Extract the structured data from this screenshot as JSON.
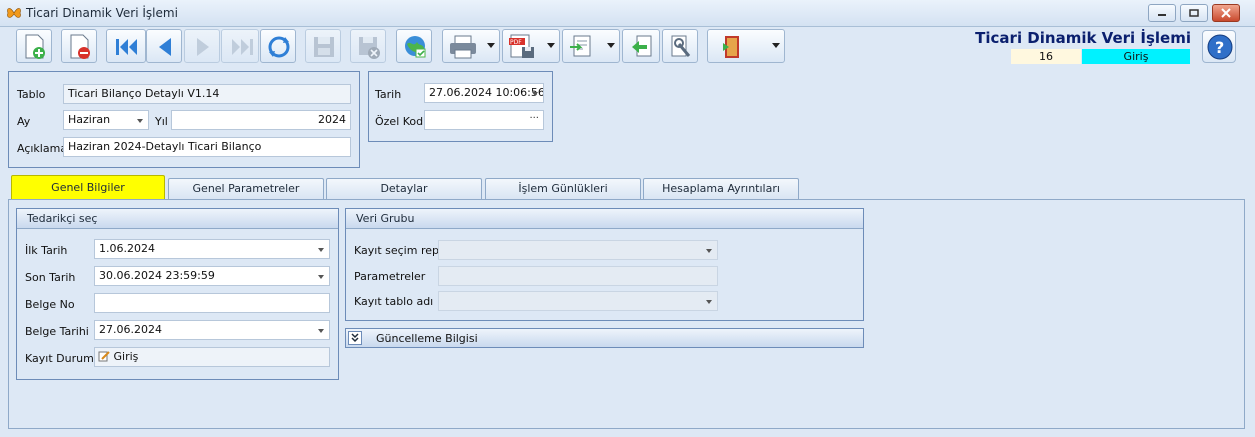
{
  "window": {
    "title": "Ticari Dinamik Veri İşlemi"
  },
  "header": {
    "title": "Ticari Dinamik Veri İşlemi",
    "count": "16",
    "status": "Giriş"
  },
  "form": {
    "tablo_label": "Tablo",
    "tablo_value": "Ticari Bilanço Detaylı V1.14",
    "ay_label": "Ay",
    "ay_value": "Haziran",
    "yil_label": "Yıl",
    "yil_value": "2024",
    "aciklama_label": "Açıklama",
    "aciklama_value": "Haziran 2024-Detaylı Ticari Bilanço",
    "tarih_label": "Tarih",
    "tarih_value": "27.06.2024 10:06:56",
    "ozel_kod_label": "Özel Kod",
    "ozel_kod_value": ""
  },
  "tabs": [
    {
      "label": "Genel Bilgiler"
    },
    {
      "label": "Genel Parametreler"
    },
    {
      "label": "Detaylar"
    },
    {
      "label": "İşlem Günlükleri"
    },
    {
      "label": "Hesaplama Ayrıntıları"
    }
  ],
  "supplier": {
    "title": "Tedarikçi seç",
    "ilk_tarih_label": "İlk Tarih",
    "ilk_tarih_value": "1.06.2024",
    "son_tarih_label": "Son Tarih",
    "son_tarih_value": "30.06.2024 23:59:59",
    "belge_no_label": "Belge No",
    "belge_no_value": "",
    "belge_tarihi_label": "Belge Tarihi",
    "belge_tarihi_value": "27.06.2024",
    "kayit_durumu_label": "Kayıt Durumu",
    "kayit_durumu_value": "Giriş"
  },
  "data_group": {
    "title": "Veri Grubu",
    "repo_label": "Kayıt seçim repo",
    "repo_value": "",
    "params_label": "Parametreler",
    "params_value": "",
    "table_label": "Kayıt tablo adı",
    "table_value": ""
  },
  "update_info": {
    "label": "Güncelleme Bilgisi"
  },
  "toolbar_icons": [
    "new-document-icon",
    "delete-document-icon",
    "first-record-icon",
    "previous-record-icon",
    "next-record-icon",
    "last-record-icon",
    "refresh-icon",
    "save-icon",
    "save-close-icon",
    "web-publish-icon",
    "print-icon",
    "pdf-export-icon",
    "import-icon",
    "back-icon",
    "tools-icon",
    "exit-icon",
    "help-icon"
  ]
}
